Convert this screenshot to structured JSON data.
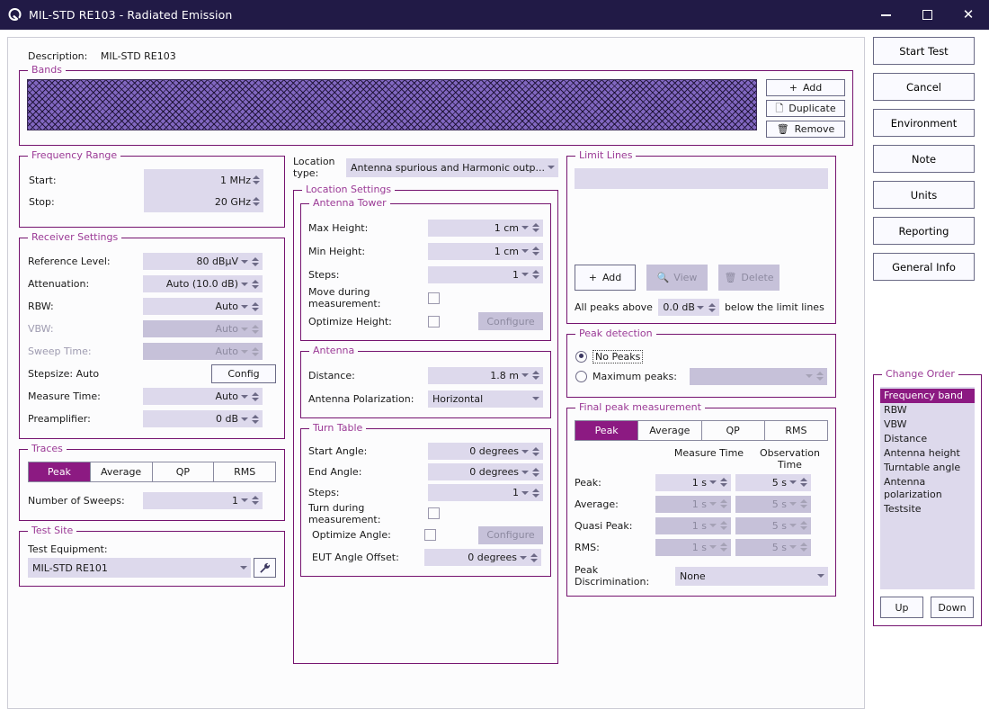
{
  "window": {
    "title": "MIL-STD RE103 - Radiated Emission",
    "logo_icon": "q-logo-icon",
    "minimize_label": "–",
    "maximize_label": "□",
    "close_label": "✕"
  },
  "description": {
    "label": "Description:",
    "value": "MIL-STD RE103"
  },
  "bands": {
    "title": "Bands",
    "buttons": [
      {
        "label": "Add",
        "icon": "plus-icon"
      },
      {
        "label": "Duplicate",
        "icon": "copy-icon"
      },
      {
        "label": "Remove",
        "icon": "trash-icon"
      }
    ]
  },
  "frequency_range": {
    "title": "Frequency Range",
    "start": {
      "label": "Start:",
      "value": "1 MHz"
    },
    "stop": {
      "label": "Stop:",
      "value": "20 GHz"
    }
  },
  "receiver_settings": {
    "title": "Receiver Settings",
    "rows": [
      {
        "label": "Reference Level:",
        "value": "80 dBµV",
        "disabled": false
      },
      {
        "label": "Attenuation:",
        "value": "Auto (10.0 dB)",
        "disabled": false
      },
      {
        "label": "RBW:",
        "value": "Auto",
        "disabled": false
      },
      {
        "label": "VBW:",
        "value": "Auto",
        "disabled": true
      },
      {
        "label": "Sweep Time:",
        "value": "Auto",
        "disabled": true
      }
    ],
    "stepsize_label": "Stepsize: Auto",
    "config_label": "Config",
    "measure_time": {
      "label": "Measure Time:",
      "value": "Auto"
    },
    "preamplifier": {
      "label": "Preamplifier:",
      "value": "0 dB"
    }
  },
  "traces": {
    "title": "Traces",
    "tabs": [
      {
        "label": "Peak",
        "active": true
      },
      {
        "label": "Average",
        "active": false
      },
      {
        "label": "QP",
        "active": false
      },
      {
        "label": "RMS",
        "active": false
      }
    ],
    "sweeps": {
      "label": "Number of Sweeps:",
      "value": "1"
    }
  },
  "test_site": {
    "title": "Test Site",
    "equipment_label": "Test Equipment:",
    "equipment_value": "MIL-STD RE101",
    "tool_icon": "wrench-icon"
  },
  "location_type": {
    "label": "Location type:",
    "value": "Antenna spurious and Harmonic outp..."
  },
  "location_settings": {
    "title": "Location Settings",
    "antenna_tower": {
      "title": "Antenna Tower",
      "max_height": {
        "label": "Max Height:",
        "value": "1 cm"
      },
      "min_height": {
        "label": "Min Height:",
        "value": "1 cm"
      },
      "steps": {
        "label": "Steps:",
        "value": "1"
      },
      "move_during": {
        "label": "Move during measurement:",
        "checked": false
      },
      "optimize_height": {
        "label": "Optimize Height:",
        "checked": false
      },
      "configure_label": "Configure"
    },
    "antenna": {
      "title": "Antenna",
      "distance": {
        "label": "Distance:",
        "value": "1.8 m"
      },
      "polarization": {
        "label": "Antenna Polarization:",
        "value": "Horizontal"
      }
    },
    "turn_table": {
      "title": "Turn Table",
      "start_angle": {
        "label": "Start Angle:",
        "value": "0 degrees"
      },
      "end_angle": {
        "label": "End Angle:",
        "value": "0 degrees"
      },
      "steps": {
        "label": "Steps:",
        "value": "1"
      },
      "turn_during": {
        "label": "Turn during measurement:",
        "checked": false
      },
      "optimize_angle": {
        "label": "Optimize Angle:",
        "checked": false
      },
      "configure_label": "Configure",
      "eut_offset": {
        "label": "EUT Angle Offset:",
        "value": "0 degrees"
      }
    }
  },
  "limit_lines": {
    "title": "Limit Lines",
    "list_items": [],
    "add_label": "Add",
    "add_icon": "plus-icon",
    "view_label": "View",
    "view_icon": "magnifier-icon",
    "delete_label": "Delete",
    "delete_icon": "trash-icon",
    "peaks_prefix": "All peaks above",
    "peaks_value": "0.0 dB",
    "peaks_suffix": "below the limit lines"
  },
  "peak_detection": {
    "title": "Peak detection",
    "no_peaks": {
      "label": "No Peaks",
      "selected": true
    },
    "maximum_peaks": {
      "label": "Maximum peaks:",
      "selected": false,
      "value": ""
    }
  },
  "final_peak": {
    "title": "Final peak measurement",
    "tabs": [
      {
        "label": "Peak",
        "active": true
      },
      {
        "label": "Average",
        "active": false
      },
      {
        "label": "QP",
        "active": false
      },
      {
        "label": "RMS",
        "active": false
      }
    ],
    "col_measure": "Measure Time",
    "col_observation": "Observation Time",
    "rows": [
      {
        "label": "Peak:",
        "measure": "1 s",
        "observation": "5 s",
        "disabled": false
      },
      {
        "label": "Average:",
        "measure": "1 s",
        "observation": "5 s",
        "disabled": true
      },
      {
        "label": "Quasi Peak:",
        "measure": "1 s",
        "observation": "5 s",
        "disabled": true
      },
      {
        "label": "RMS:",
        "measure": "1 s",
        "observation": "5 s",
        "disabled": true
      }
    ],
    "discrimination": {
      "label": "Peak Discrimination:",
      "value": "None"
    }
  },
  "side_buttons": [
    {
      "label": "Start Test"
    },
    {
      "label": "Cancel"
    },
    {
      "label": "Environment"
    },
    {
      "label": "Note"
    },
    {
      "label": "Units"
    },
    {
      "label": "Reporting"
    },
    {
      "label": "General Info"
    }
  ],
  "change_order": {
    "title": "Change Order",
    "items": [
      {
        "label": "Frequency band",
        "selected": true
      },
      {
        "label": "RBW",
        "selected": false
      },
      {
        "label": "VBW",
        "selected": false
      },
      {
        "label": "Distance",
        "selected": false
      },
      {
        "label": "Antenna height",
        "selected": false
      },
      {
        "label": "Turntable angle",
        "selected": false
      },
      {
        "label": "Antenna polarization",
        "selected": false
      },
      {
        "label": "Testsite",
        "selected": false
      }
    ],
    "up_label": "Up",
    "down_label": "Down"
  },
  "colors": {
    "titlebar": "#211a46",
    "accent": "#8c1a82",
    "group_border": "#75136f",
    "group_title": "#9b3a96",
    "field_bg": "#ddd9ec",
    "field_disabled_bg": "#c6c1d9",
    "band_fill": "#8167c0"
  }
}
